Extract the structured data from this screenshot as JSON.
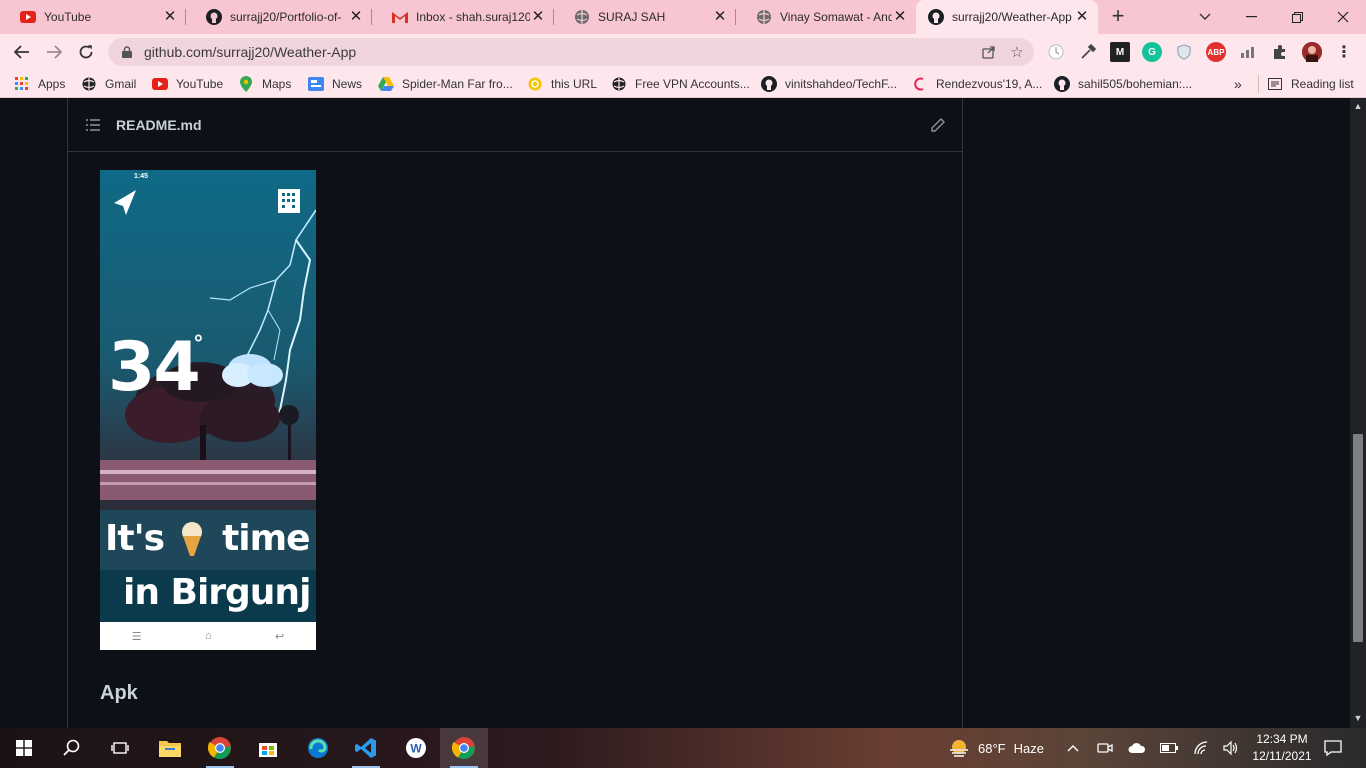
{
  "tabs": [
    {
      "title": "YouTube",
      "icon": "youtube-icon"
    },
    {
      "title": "surrajj20/Portfolio-of-",
      "icon": "github-icon"
    },
    {
      "title": "Inbox - shah.suraj120",
      "icon": "gmail-icon"
    },
    {
      "title": "SURAJ SAH",
      "icon": "globe-icon"
    },
    {
      "title": "Vinay Somawat - And",
      "icon": "globe-icon"
    },
    {
      "title": "surrajj20/Weather-App",
      "icon": "github-icon",
      "active": true
    }
  ],
  "address": {
    "url": "github.com/surrajj20/Weather-App"
  },
  "bookmarks": [
    {
      "label": "Apps",
      "icon": "apps-grid-icon"
    },
    {
      "label": "Gmail",
      "icon": "globe-icon"
    },
    {
      "label": "YouTube",
      "icon": "youtube-icon"
    },
    {
      "label": "Maps",
      "icon": "maps-icon"
    },
    {
      "label": "News",
      "icon": "news-icon"
    },
    {
      "label": "Spider-Man Far fro...",
      "icon": "drive-icon"
    },
    {
      "label": "this URL",
      "icon": "globe-icon"
    },
    {
      "label": "Free VPN Accounts...",
      "icon": "globe-icon"
    },
    {
      "label": "vinitshahdeo/TechF...",
      "icon": "github-icon"
    },
    {
      "label": "Rendezvous'19, A...",
      "icon": "bookmark-icon"
    },
    {
      "label": "sahil505/bohemian:...",
      "icon": "github-icon"
    }
  ],
  "bookmarks_overflow": "»",
  "reading_list": "Reading list",
  "readme": {
    "filename": "README.md"
  },
  "phone": {
    "time": "1:45",
    "temperature": "34",
    "degree": "°",
    "line1_a": "It's",
    "line1_b": "time",
    "line2": "in Birgunj"
  },
  "section": {
    "heading": "Apk"
  },
  "taskbar": {
    "weather_temp": "68°F",
    "weather_desc": "Haze",
    "time": "12:34 PM",
    "date": "12/11/2021"
  },
  "colors": {
    "tabstrip": "#f7c6d2",
    "toolbar": "#fde7ed",
    "page_bg": "#0d1117",
    "border": "#30363d",
    "text": "#c9d1d9"
  }
}
